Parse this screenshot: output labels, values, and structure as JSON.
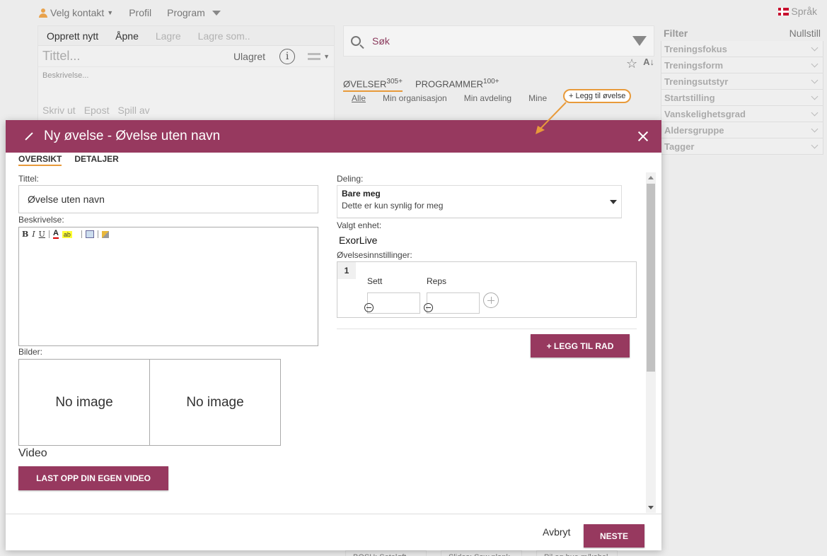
{
  "topnav": {
    "contact": "Velg kontakt",
    "profile": "Profil",
    "program": "Program",
    "language": "Språk"
  },
  "left_panel": {
    "toolbar": [
      "Opprett nytt",
      "Åpne",
      "Lagre",
      "Lagre som.."
    ],
    "title_placeholder": "Tittel...",
    "status": "Ulagret",
    "description_placeholder": "Beskrivelse...",
    "actions": [
      "Skriv ut",
      "Epost",
      "Spill av"
    ]
  },
  "mid_panel": {
    "search_placeholder": "Søk",
    "tab_exercises": "ØVELSER",
    "tab_exercises_count": "305+",
    "tab_programs": "PROGRAMMER",
    "tab_programs_count": "100+",
    "sub_tabs": [
      "Alle",
      "Min organisasjon",
      "Min avdeling",
      "Mine"
    ],
    "add_exercise_callout": "+ Legg til øvelse",
    "bottom_cards": [
      "BOSU: Seteløft m/...",
      "Slides: Saw plank",
      "Pil og bue m/kabel"
    ]
  },
  "filter_panel": {
    "title": "Filter",
    "reset": "Nullstill",
    "items": [
      "Treningsfokus",
      "Treningsform",
      "Treningsutstyr",
      "Startstilling",
      "Vanskelighetsgrad",
      "Aldersgruppe",
      "Tagger"
    ]
  },
  "modal": {
    "title": "Ny øvelse - Øvelse uten navn",
    "tabs": [
      "OVERSIKT",
      "DETALJER"
    ],
    "title_label": "Tittel:",
    "title_value": "Øvelse uten navn",
    "description_label": "Beskrivelse:",
    "images_label": "Bilder:",
    "no_image": "No image",
    "video_label": "Video",
    "upload_video_button": "LAST OPP DIN EGEN VIDEO",
    "sharing_label": "Deling:",
    "sharing_value": "Bare meg",
    "sharing_desc": "Dette er kun synlig for meg",
    "unit_label": "Valgt enhet:",
    "unit_value": "ExorLive",
    "settings_label": "Øvelsesinnstillinger:",
    "row_number": "1",
    "sets_label": "Sett",
    "reps_label": "Reps",
    "add_row_button": "+ LEGG TIL RAD",
    "cancel_button": "Avbryt",
    "next_button": "NESTE"
  },
  "colors": {
    "brand": "#97395f",
    "accent": "#e89a3a"
  }
}
